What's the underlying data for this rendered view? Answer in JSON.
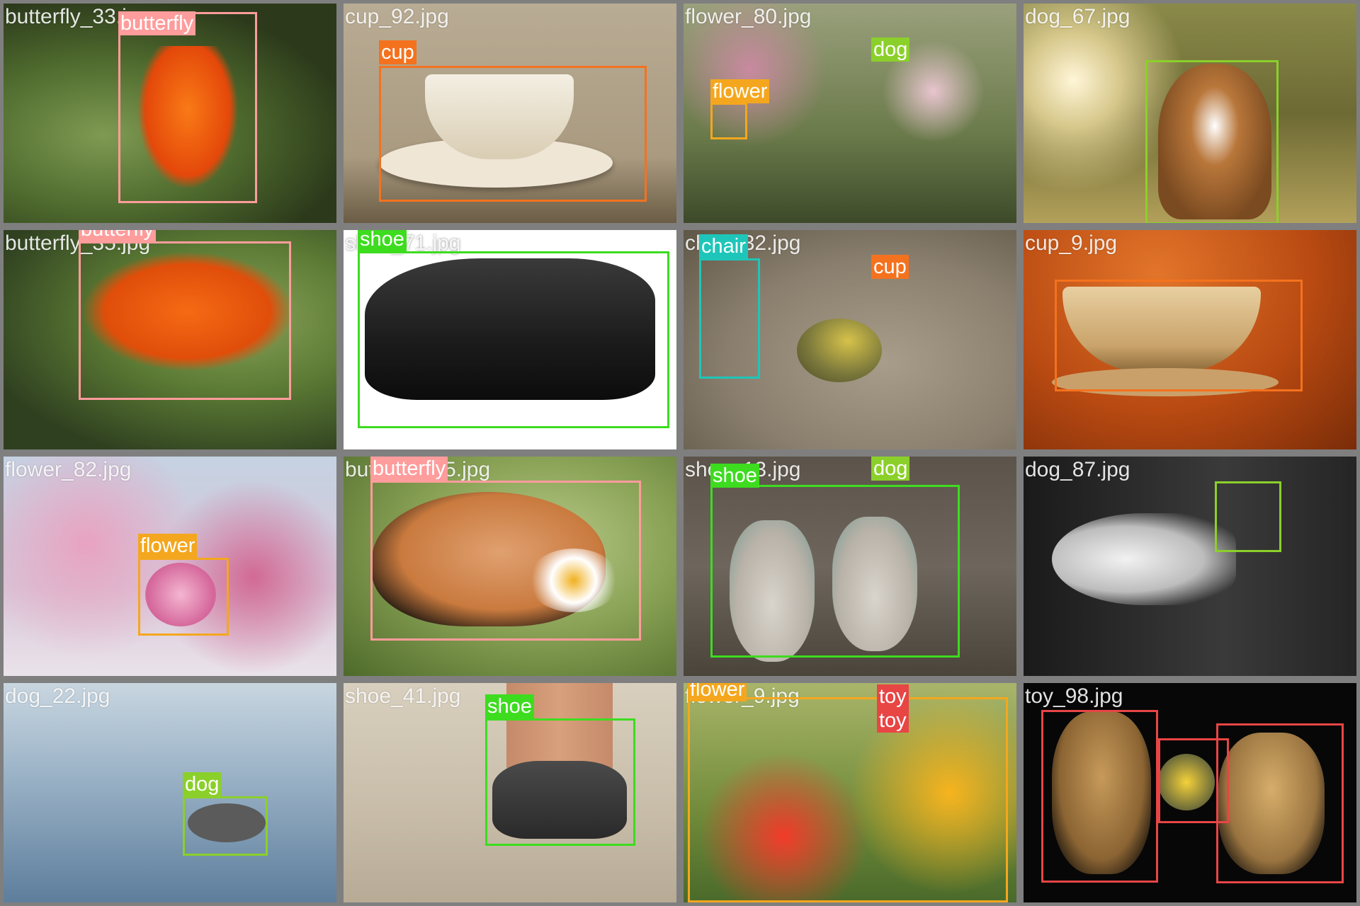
{
  "mosaic": {
    "tiles": [
      {
        "filename": "butterfly_33.jpg",
        "labels": [
          "butterfly"
        ]
      },
      {
        "filename": "cup_92.jpg",
        "labels": [
          "cup"
        ]
      },
      {
        "filename": "flower_80.jpg",
        "labels": [
          "dog",
          "flower"
        ]
      },
      {
        "filename": "dog_67.jpg",
        "labels": []
      },
      {
        "filename": "butterfly_35.jpg",
        "labels": [
          "butterfly"
        ]
      },
      {
        "filename": "shoe_71.jpg",
        "labels": [
          "shoe"
        ]
      },
      {
        "filename": "chair_32.jpg",
        "labels": [
          "chair",
          "cup"
        ]
      },
      {
        "filename": "cup_9.jpg",
        "labels": []
      },
      {
        "filename": "flower_82.jpg",
        "labels": [
          "flower"
        ]
      },
      {
        "filename": "butterfly_15.jpg",
        "labels": [
          "butterfly"
        ]
      },
      {
        "filename": "shoe_13.jpg",
        "labels": [
          "shoe",
          "dog"
        ]
      },
      {
        "filename": "dog_87.jpg",
        "labels": []
      },
      {
        "filename": "dog_22.jpg",
        "labels": [
          "dog"
        ]
      },
      {
        "filename": "shoe_41.jpg",
        "labels": [
          "shoe"
        ]
      },
      {
        "filename": "flower_9.jpg",
        "labels": [
          "flower",
          "toy",
          "toy"
        ]
      },
      {
        "filename": "toy_98.jpg",
        "labels": []
      }
    ]
  },
  "colors": {
    "butterfly": "#ff9c9c",
    "cup": "#f4721e",
    "dog": "#8bd02a",
    "flower": "#f4a71e",
    "shoe": "#3ddc1f",
    "chair": "#1ec6b9",
    "toy": "#e84545",
    "border": "#7f7f7f"
  }
}
